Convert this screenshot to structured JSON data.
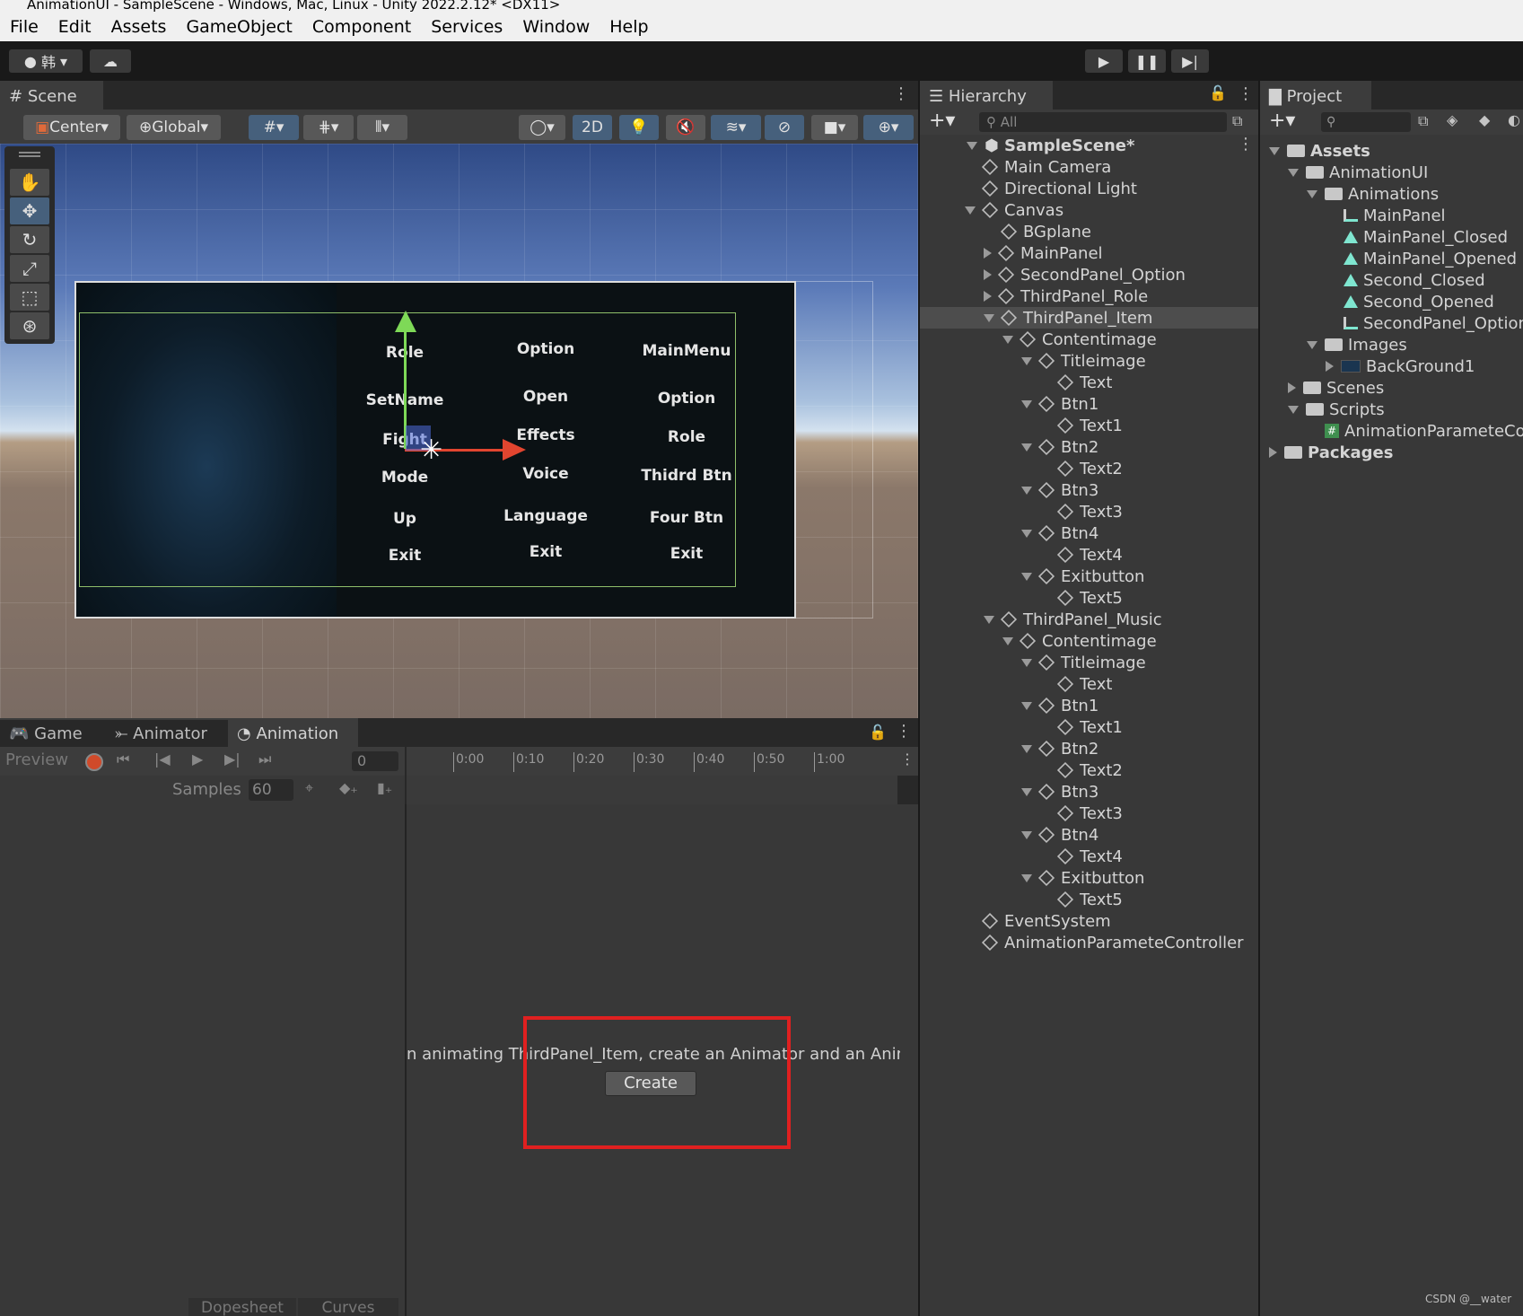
{
  "window": {
    "title": "AnimationUI - SampleScene - Windows, Mac, Linux - Unity 2022.2.12* <DX11>"
  },
  "menu": [
    "File",
    "Edit",
    "Assets",
    "GameObject",
    "Component",
    "Services",
    "Window",
    "Help"
  ],
  "toolbar": {
    "account_label": "韩",
    "play_icon": "play-icon",
    "pause_icon": "pause-icon",
    "step_icon": "step-icon"
  },
  "scene": {
    "tab": "Scene",
    "pivot": "Center",
    "space": "Global",
    "mode_2d": "2D",
    "col1": [
      "Role",
      "SetName",
      "Fight",
      "Mode",
      "Up",
      "Exit"
    ],
    "col2": [
      "Option",
      "Open",
      "Effects",
      "Voice",
      "Language",
      "Exit"
    ],
    "col3": [
      "MainMenu",
      "Option",
      "Role",
      "Thidrd Btn",
      "Four Btn",
      "Exit"
    ]
  },
  "hierarchy": {
    "tab": "Hierarchy",
    "search_placeholder": "All",
    "scene_name": "SampleScene*",
    "items": [
      {
        "label": "Main Camera",
        "depth": 1,
        "arrow": "none"
      },
      {
        "label": "Directional Light",
        "depth": 1,
        "arrow": "none"
      },
      {
        "label": "Canvas",
        "depth": 1,
        "arrow": "down"
      },
      {
        "label": "BGplane",
        "depth": 2,
        "arrow": "none"
      },
      {
        "label": "MainPanel",
        "depth": 2,
        "arrow": "right"
      },
      {
        "label": "SecondPanel_Option",
        "depth": 2,
        "arrow": "right"
      },
      {
        "label": "ThirdPanel_Role",
        "depth": 2,
        "arrow": "right"
      },
      {
        "label": "ThirdPanel_Item",
        "depth": 2,
        "arrow": "down",
        "selected": true
      },
      {
        "label": "Contentimage",
        "depth": 3,
        "arrow": "down"
      },
      {
        "label": "Titleimage",
        "depth": 4,
        "arrow": "down"
      },
      {
        "label": "Text",
        "depth": 5,
        "arrow": "none"
      },
      {
        "label": "Btn1",
        "depth": 4,
        "arrow": "down"
      },
      {
        "label": "Text1",
        "depth": 5,
        "arrow": "none"
      },
      {
        "label": "Btn2",
        "depth": 4,
        "arrow": "down"
      },
      {
        "label": "Text2",
        "depth": 5,
        "arrow": "none"
      },
      {
        "label": "Btn3",
        "depth": 4,
        "arrow": "down"
      },
      {
        "label": "Text3",
        "depth": 5,
        "arrow": "none"
      },
      {
        "label": "Btn4",
        "depth": 4,
        "arrow": "down"
      },
      {
        "label": "Text4",
        "depth": 5,
        "arrow": "none"
      },
      {
        "label": "Exitbutton",
        "depth": 4,
        "arrow": "down"
      },
      {
        "label": "Text5",
        "depth": 5,
        "arrow": "none"
      },
      {
        "label": "ThirdPanel_Music",
        "depth": 2,
        "arrow": "down"
      },
      {
        "label": "Contentimage",
        "depth": 3,
        "arrow": "down"
      },
      {
        "label": "Titleimage",
        "depth": 4,
        "arrow": "down"
      },
      {
        "label": "Text",
        "depth": 5,
        "arrow": "none"
      },
      {
        "label": "Btn1",
        "depth": 4,
        "arrow": "down"
      },
      {
        "label": "Text1",
        "depth": 5,
        "arrow": "none"
      },
      {
        "label": "Btn2",
        "depth": 4,
        "arrow": "down"
      },
      {
        "label": "Text2",
        "depth": 5,
        "arrow": "none"
      },
      {
        "label": "Btn3",
        "depth": 4,
        "arrow": "down"
      },
      {
        "label": "Text3",
        "depth": 5,
        "arrow": "none"
      },
      {
        "label": "Btn4",
        "depth": 4,
        "arrow": "down"
      },
      {
        "label": "Text4",
        "depth": 5,
        "arrow": "none"
      },
      {
        "label": "Exitbutton",
        "depth": 4,
        "arrow": "down"
      },
      {
        "label": "Text5",
        "depth": 5,
        "arrow": "none"
      },
      {
        "label": "EventSystem",
        "depth": 1,
        "arrow": "none"
      },
      {
        "label": "AnimationParameteController",
        "depth": 1,
        "arrow": "none"
      }
    ]
  },
  "project": {
    "tab": "Project",
    "items": [
      {
        "label": "Assets",
        "depth": 0,
        "arrow": "down",
        "icon": "folder",
        "bold": true
      },
      {
        "label": "AnimationUI",
        "depth": 1,
        "arrow": "down",
        "icon": "folder"
      },
      {
        "label": "Animations",
        "depth": 2,
        "arrow": "down",
        "icon": "folder"
      },
      {
        "label": "MainPanel",
        "depth": 3,
        "arrow": "none",
        "icon": "controller"
      },
      {
        "label": "MainPanel_Closed",
        "depth": 3,
        "arrow": "none",
        "icon": "anim"
      },
      {
        "label": "MainPanel_Opened",
        "depth": 3,
        "arrow": "none",
        "icon": "anim"
      },
      {
        "label": "Second_Closed",
        "depth": 3,
        "arrow": "none",
        "icon": "anim"
      },
      {
        "label": "Second_Opened",
        "depth": 3,
        "arrow": "none",
        "icon": "anim"
      },
      {
        "label": "SecondPanel_Option",
        "depth": 3,
        "arrow": "none",
        "icon": "controller"
      },
      {
        "label": "Images",
        "depth": 2,
        "arrow": "down",
        "icon": "folder"
      },
      {
        "label": "BackGround1",
        "depth": 3,
        "arrow": "right",
        "icon": "image"
      },
      {
        "label": "Scenes",
        "depth": 1,
        "arrow": "right",
        "icon": "folder"
      },
      {
        "label": "Scripts",
        "depth": 1,
        "arrow": "down",
        "icon": "folder"
      },
      {
        "label": "AnimationParameteCon",
        "depth": 2,
        "arrow": "none",
        "icon": "script"
      },
      {
        "label": "Packages",
        "depth": 0,
        "arrow": "right",
        "icon": "folder",
        "bold": true
      }
    ]
  },
  "bottom": {
    "tabs": [
      "Game",
      "Animator",
      "Animation"
    ],
    "preview": "Preview",
    "frame": "0",
    "samples_label": "Samples",
    "samples_value": "60",
    "time_ticks": [
      "0:00",
      "0:10",
      "0:20",
      "0:30",
      "0:40",
      "0:50",
      "1:00"
    ],
    "message": "n animating ThirdPanel_Item, create an Animator and an Animati",
    "create_button": "Create",
    "dopesheet": "Dopesheet",
    "curves": "Curves"
  },
  "watermark": "CSDN @__water",
  "colors": {
    "highlight_red": "#e02020",
    "selected_row": "#4d4d4d",
    "record_red": "#d04a2a"
  }
}
